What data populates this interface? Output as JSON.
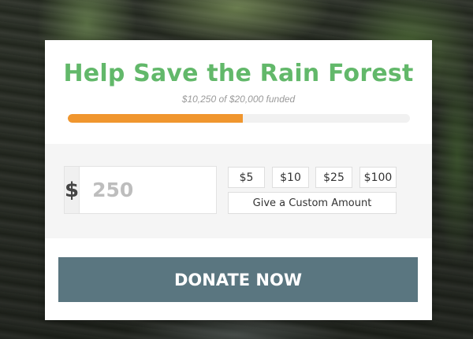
{
  "campaign": {
    "title": "Help Save the Rain Forest",
    "funded_text": "$10,250 of $20,000 funded",
    "progress_fraction": 0.5125,
    "colors": {
      "title": "#62b86a",
      "progress": "#f0962e",
      "button": "#5a7680"
    }
  },
  "donation": {
    "currency_symbol": "$",
    "amount_value": "250",
    "presets": [
      "$5",
      "$10",
      "$25",
      "$100"
    ],
    "custom_label": "Give a Custom Amount"
  },
  "actions": {
    "donate_label": "DONATE NOW"
  }
}
